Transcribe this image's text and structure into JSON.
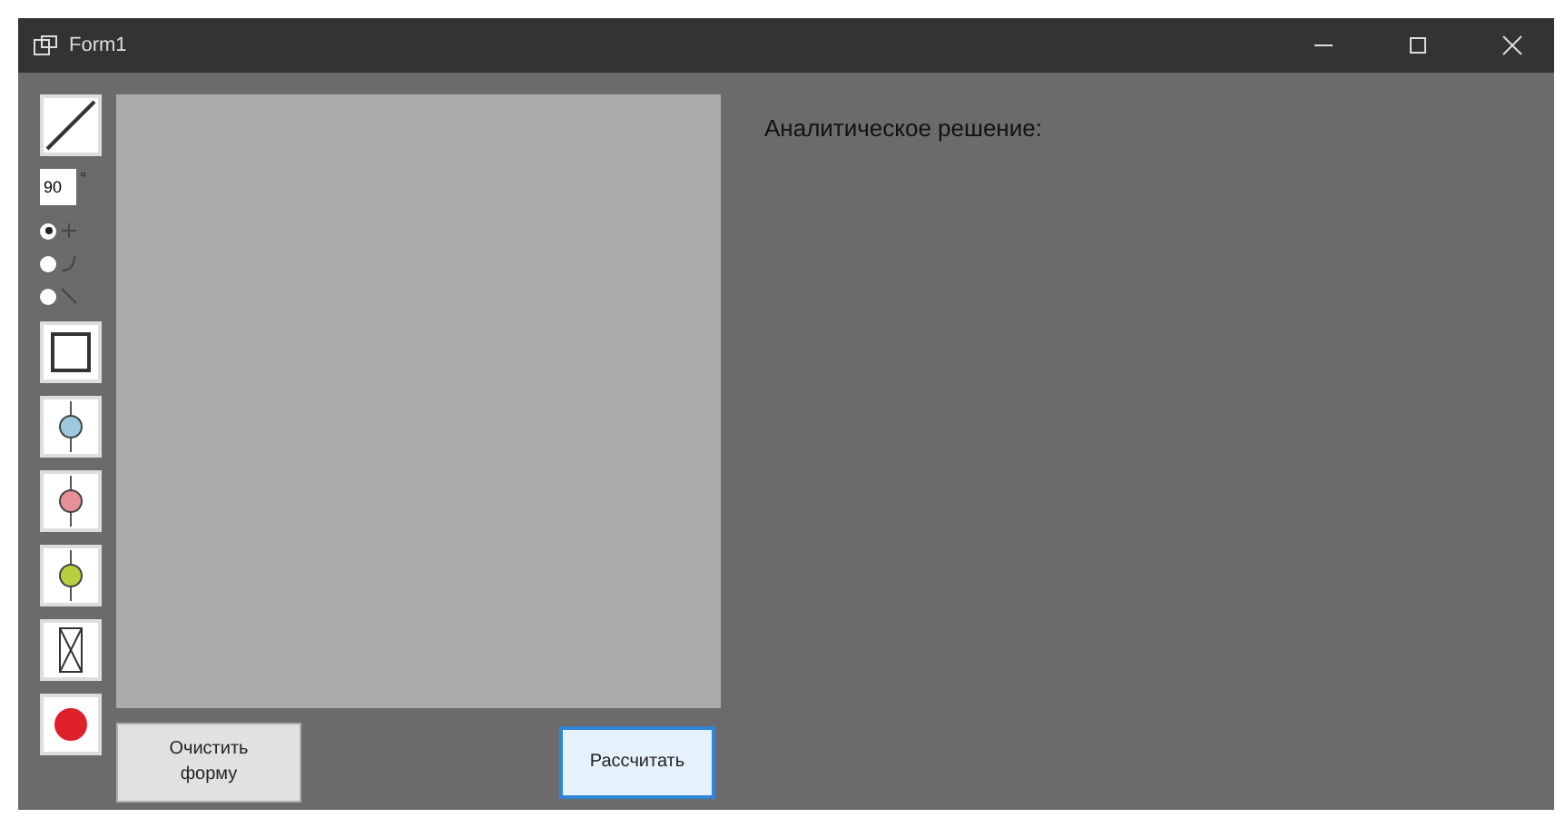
{
  "window": {
    "title": "Form1"
  },
  "tools": {
    "angle": {
      "value": "90",
      "unit": "°"
    },
    "radios": [
      {
        "kind": "straight",
        "selected": true
      },
      {
        "kind": "curve",
        "selected": false
      },
      {
        "kind": "slant",
        "selected": false
      }
    ]
  },
  "buttons": [
    {
      "label": "Очистить\nформу",
      "focused": false
    },
    {
      "label": "Рассчитать",
      "focused": true
    }
  ],
  "result": {
    "heading": "Аналитическое решение:"
  }
}
